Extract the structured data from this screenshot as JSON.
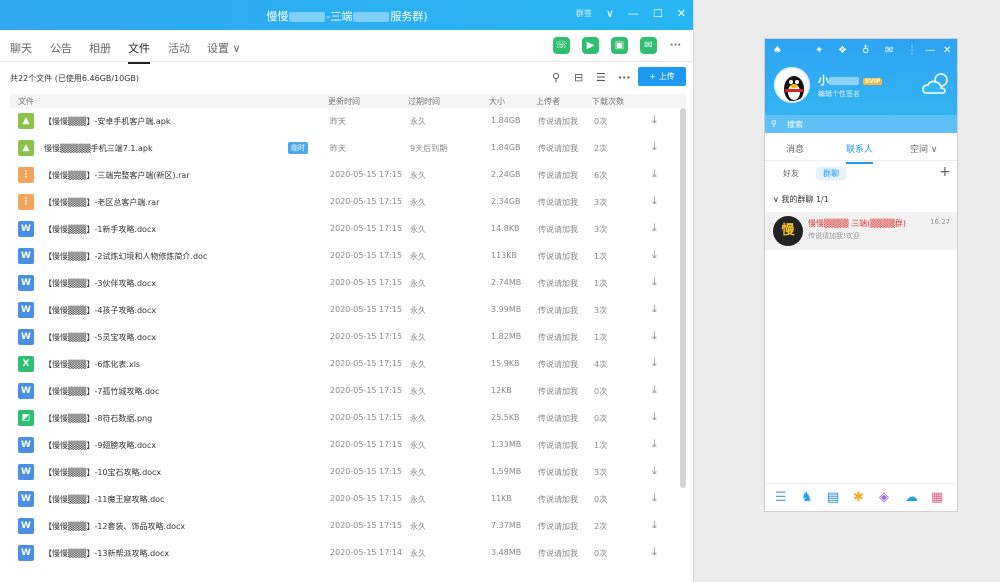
{
  "window": {
    "title_pre": "慢慢",
    "title_mid": "-三端",
    "title_post": "服务群)",
    "ctrl_more": "群签",
    "ctrl_chevron": "∨",
    "ctrl_min": "—",
    "ctrl_max": "☐",
    "ctrl_close": "✕"
  },
  "tabs": [
    {
      "label": "聊天"
    },
    {
      "label": "公告"
    },
    {
      "label": "相册"
    },
    {
      "label": "文件"
    },
    {
      "label": "活动"
    },
    {
      "label": "设置 ∨"
    }
  ],
  "toolbar": {
    "phone": "☏",
    "video": "▶",
    "screen": "▣",
    "msg": "✉",
    "more": "···"
  },
  "filebar": {
    "info": "共22个文件 (已使用6.46GB/10GB)",
    "search": "⚲",
    "save": "⊟",
    "list": "☰",
    "more": "···",
    "upload": "+ 上传"
  },
  "columns": {
    "file": "文件",
    "time": "更新时间",
    "expire": "过期时间",
    "size": "大小",
    "uploader": "上传者",
    "downloads": "下载次数"
  },
  "files": [
    {
      "icon": "apk",
      "icon_color": "#8bc34a",
      "glyph": "▲",
      "name": "【慢慢▒▒▒】-安卓手机客户端.apk",
      "tag": "",
      "time": "昨天",
      "expire": "永久",
      "size": "1.84GB",
      "uploader": "传说请加我",
      "downloads": "0次"
    },
    {
      "icon": "apk",
      "icon_color": "#8bc34a",
      "glyph": "▲",
      "name": "慢慢▒▒▒▒▒手机三端7.1.apk",
      "tag": "临时",
      "time": "昨天",
      "expire": "9天后到期",
      "size": "1.84GB",
      "uploader": "传说请加我",
      "downloads": "2次"
    },
    {
      "icon": "rar",
      "icon_color": "#f3a45c",
      "glyph": "⋮",
      "name": "【慢慢▒▒▒】-三端完整客户端(新区).rar",
      "tag": "",
      "time": "2020-05-15 17:15",
      "expire": "永久",
      "size": "2.24GB",
      "uploader": "传说请加我",
      "downloads": "6次"
    },
    {
      "icon": "rar",
      "icon_color": "#f3a45c",
      "glyph": "⋮",
      "name": "【慢慢▒▒▒】-老区总客户端.rar",
      "tag": "",
      "time": "2020-05-15 17:15",
      "expire": "永久",
      "size": "2.34GB",
      "uploader": "传说请加我",
      "downloads": "3次"
    },
    {
      "icon": "doc",
      "icon_color": "#4a90e2",
      "glyph": "W",
      "name": "【慢慢▒▒▒】-1新手攻略.docx",
      "tag": "",
      "time": "2020-05-15 17:15",
      "expire": "永久",
      "size": "14.8KB",
      "uploader": "传说请加我",
      "downloads": "3次"
    },
    {
      "icon": "doc",
      "icon_color": "#4a90e2",
      "glyph": "W",
      "name": "【慢慢▒▒▒】-2试炼幻境和人物修炼简介.doc",
      "tag": "",
      "time": "2020-05-15 17:15",
      "expire": "永久",
      "size": "113KB",
      "uploader": "传说请加我",
      "downloads": "1次"
    },
    {
      "icon": "doc",
      "icon_color": "#4a90e2",
      "glyph": "W",
      "name": "【慢慢▒▒▒】-3伙伴攻略.docx",
      "tag": "",
      "time": "2020-05-15 17:15",
      "expire": "永久",
      "size": "2.74MB",
      "uploader": "传说请加我",
      "downloads": "1次"
    },
    {
      "icon": "doc",
      "icon_color": "#4a90e2",
      "glyph": "W",
      "name": "【慢慢▒▒▒】-4孩子攻略.docx",
      "tag": "",
      "time": "2020-05-15 17:15",
      "expire": "永久",
      "size": "3.99MB",
      "uploader": "传说请加我",
      "downloads": "3次"
    },
    {
      "icon": "doc",
      "icon_color": "#4a90e2",
      "glyph": "W",
      "name": "【慢慢▒▒▒】-5灵宝攻略.docx",
      "tag": "",
      "time": "2020-05-15 17:15",
      "expire": "永久",
      "size": "1.82MB",
      "uploader": "传说请加我",
      "downloads": "1次"
    },
    {
      "icon": "xls",
      "icon_color": "#2fbf71",
      "glyph": "X",
      "name": "【慢慢▒▒▒】-6炼化表.xls",
      "tag": "",
      "time": "2020-05-15 17:15",
      "expire": "永久",
      "size": "15.9KB",
      "uploader": "传说请加我",
      "downloads": "4次"
    },
    {
      "icon": "doc",
      "icon_color": "#4a90e2",
      "glyph": "W",
      "name": "【慢慢▒▒▒】-7孤竹城攻略.doc",
      "tag": "",
      "time": "2020-05-15 17:15",
      "expire": "永久",
      "size": "12KB",
      "uploader": "传说请加我",
      "downloads": "0次"
    },
    {
      "icon": "png",
      "icon_color": "#2fbf71",
      "glyph": "◩",
      "name": "【慢慢▒▒▒】-8符石数据.png",
      "tag": "",
      "time": "2020-05-15 17:15",
      "expire": "永久",
      "size": "25.5KB",
      "uploader": "传说请加我",
      "downloads": "0次"
    },
    {
      "icon": "doc",
      "icon_color": "#4a90e2",
      "glyph": "W",
      "name": "【慢慢▒▒▒】-9翅膀攻略.docx",
      "tag": "",
      "time": "2020-05-15 17:15",
      "expire": "永久",
      "size": "1.33MB",
      "uploader": "传说请加我",
      "downloads": "1次"
    },
    {
      "icon": "doc",
      "icon_color": "#4a90e2",
      "glyph": "W",
      "name": "【慢慢▒▒▒】-10宝石攻略.docx",
      "tag": "",
      "time": "2020-05-15 17:15",
      "expire": "永久",
      "size": "1.59MB",
      "uploader": "传说请加我",
      "downloads": "3次"
    },
    {
      "icon": "doc",
      "icon_color": "#4a90e2",
      "glyph": "W",
      "name": "【慢慢▒▒▒】-11魔王窟攻略.doc",
      "tag": "",
      "time": "2020-05-15 17:15",
      "expire": "永久",
      "size": "11KB",
      "uploader": "传说请加我",
      "downloads": "0次"
    },
    {
      "icon": "doc",
      "icon_color": "#4a90e2",
      "glyph": "W",
      "name": "【慢慢▒▒▒】-12套装、饰品攻略.docx",
      "tag": "",
      "time": "2020-05-15 17:15",
      "expire": "永久",
      "size": "7.37MB",
      "uploader": "传说请加我",
      "downloads": "2次"
    },
    {
      "icon": "doc",
      "icon_color": "#4a90e2",
      "glyph": "W",
      "name": "【慢慢▒▒▒】-13新帮派攻略.docx",
      "tag": "",
      "time": "2020-05-15 17:14",
      "expire": "永久",
      "size": "3.48MB",
      "uploader": "传说请加我",
      "downloads": "0次"
    }
  ],
  "panel": {
    "top_icons": [
      "♠",
      "✦",
      "❖",
      "♁",
      "✉",
      "⋮",
      "—",
      "✕"
    ],
    "nickname": "小",
    "vip": "SVIP",
    "signature": "编辑个性签名",
    "search_icon": "⚲",
    "search_placeholder": "搜索",
    "tabs": [
      "消息",
      "联系人",
      "空间 ∨"
    ],
    "subtabs": [
      "好友",
      "群聊"
    ],
    "plus": "+",
    "group_header": "∨  我的群聊  1/1",
    "group_item": {
      "avatar_char": "慢",
      "name": "慢慢▒▒▒▒ 三端(▒▒▒▒群)",
      "time": "16:27",
      "message": "传说请加我!欢迎"
    },
    "bottom_icons": [
      {
        "glyph": "☰",
        "color": "#5a9fd6"
      },
      {
        "glyph": "♞",
        "color": "#1ea0e8"
      },
      {
        "glyph": "▤",
        "color": "#1e88e5"
      },
      {
        "glyph": "✱",
        "color": "#f5a623"
      },
      {
        "glyph": "◈",
        "color": "#9c6ade"
      },
      {
        "glyph": "☁",
        "color": "#1ea0e8"
      },
      {
        "glyph": "▦",
        "color": "#e85c8a"
      }
    ]
  }
}
